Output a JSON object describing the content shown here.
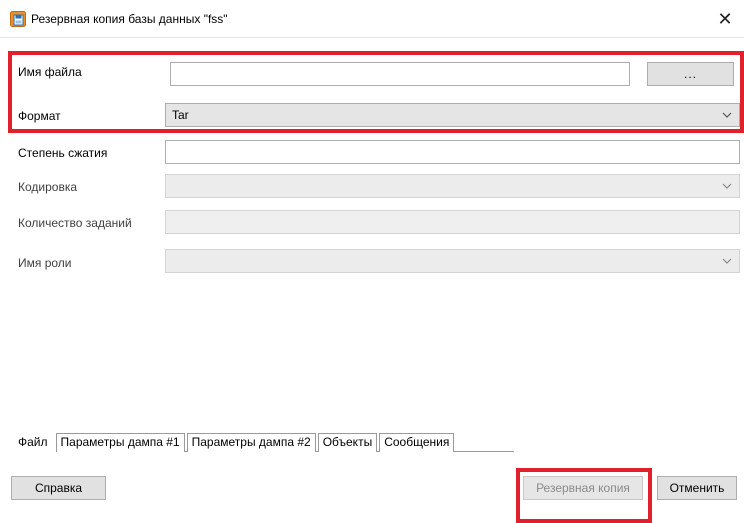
{
  "window": {
    "title": "Резервная копия базы данных \"fss\"",
    "close_glyph": "✕"
  },
  "form": {
    "filename": {
      "label": "Имя файла",
      "value": "",
      "browse_label": "..."
    },
    "format": {
      "label": "Формат",
      "value": "Tar"
    },
    "compression": {
      "label": "Степень сжатия",
      "value": ""
    },
    "encoding": {
      "label": "Кодировка",
      "value": ""
    },
    "jobs": {
      "label": "Количество заданий",
      "value": ""
    },
    "role": {
      "label": "Имя роли",
      "value": ""
    }
  },
  "tabs": [
    {
      "label": "Файл",
      "active": true
    },
    {
      "label": "Параметры дампа #1"
    },
    {
      "label": "Параметры дампа #2"
    },
    {
      "label": "Объекты"
    },
    {
      "label": "Сообщения"
    }
  ],
  "buttons": {
    "help": "Справка",
    "backup": "Резервная копия",
    "cancel": "Отменить"
  },
  "colors": {
    "highlight": "#e2202c",
    "icon_orange": "#e8912d",
    "icon_blue": "#2f6fb6"
  }
}
